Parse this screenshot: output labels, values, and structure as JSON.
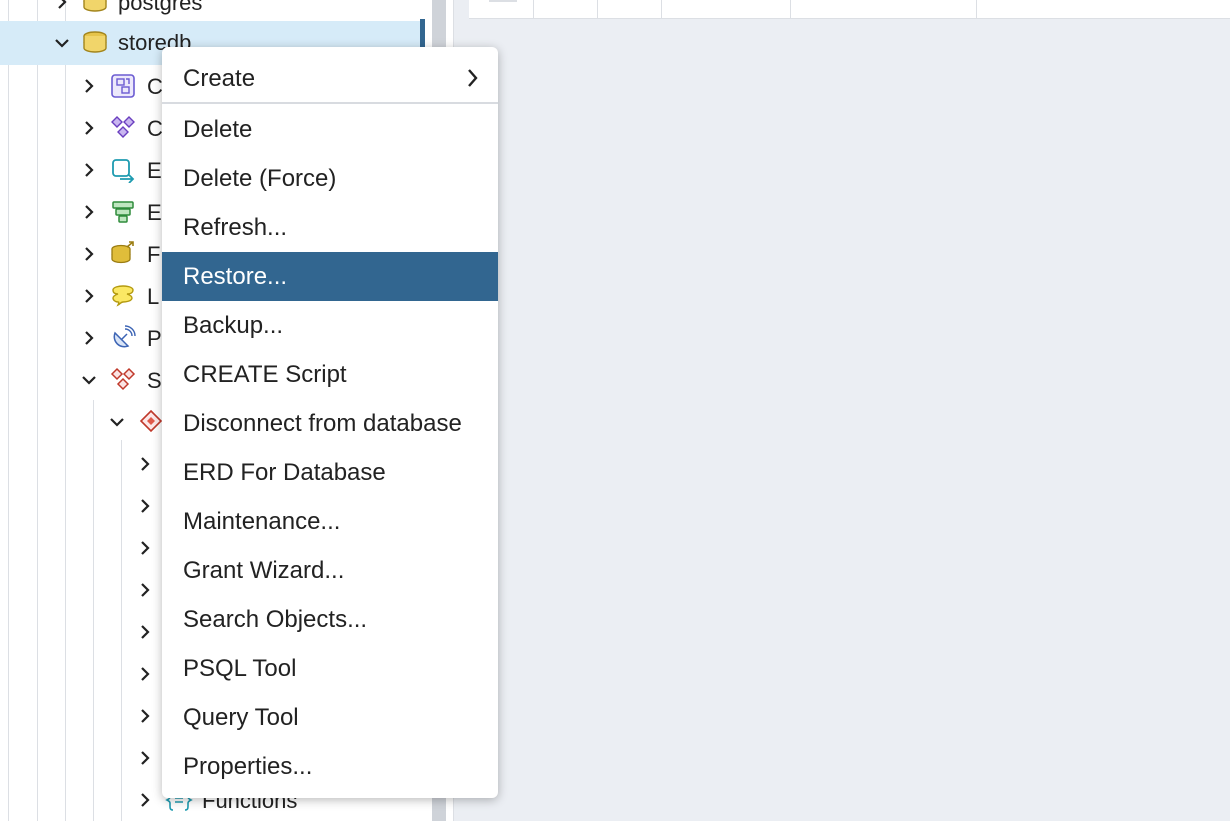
{
  "tree": {
    "top_item": {
      "label": "postgres",
      "icon": "database-icon"
    },
    "selected_item": {
      "label": "storedb",
      "icon": "database-icon"
    },
    "children": [
      {
        "label": "C",
        "icon": "casts-icon"
      },
      {
        "label": "C",
        "icon": "catalogs-icon"
      },
      {
        "label": "E",
        "icon": "event-triggers-icon"
      },
      {
        "label": "E",
        "icon": "extensions-icon"
      },
      {
        "label": "F",
        "icon": "foreign-data-wrappers-icon"
      },
      {
        "label": "L",
        "icon": "languages-icon"
      },
      {
        "label": "P",
        "icon": "publications-icon"
      },
      {
        "label": "S",
        "icon": "schemas-icon"
      }
    ],
    "schema_item": {
      "icon": "schema-icon"
    },
    "last_visible_item": {
      "label": "Functions",
      "icon": "functions-icon"
    }
  },
  "context_menu": {
    "items": [
      {
        "label": "Create",
        "has_submenu": true
      },
      {
        "label": "Delete"
      },
      {
        "label": "Delete (Force)"
      },
      {
        "label": "Refresh..."
      },
      {
        "label": "Restore...",
        "highlighted": true
      },
      {
        "label": "Backup..."
      },
      {
        "label": "CREATE Script"
      },
      {
        "label": "Disconnect from database"
      },
      {
        "label": "ERD For Database"
      },
      {
        "label": "Maintenance..."
      },
      {
        "label": "Grant Wizard..."
      },
      {
        "label": "Search Objects..."
      },
      {
        "label": "PSQL Tool"
      },
      {
        "label": "Query Tool"
      },
      {
        "label": "Properties..."
      }
    ]
  },
  "colors": {
    "selection_bg": "#d6ebf8",
    "accent": "#326690",
    "workspace_bg": "#ebeef3"
  }
}
